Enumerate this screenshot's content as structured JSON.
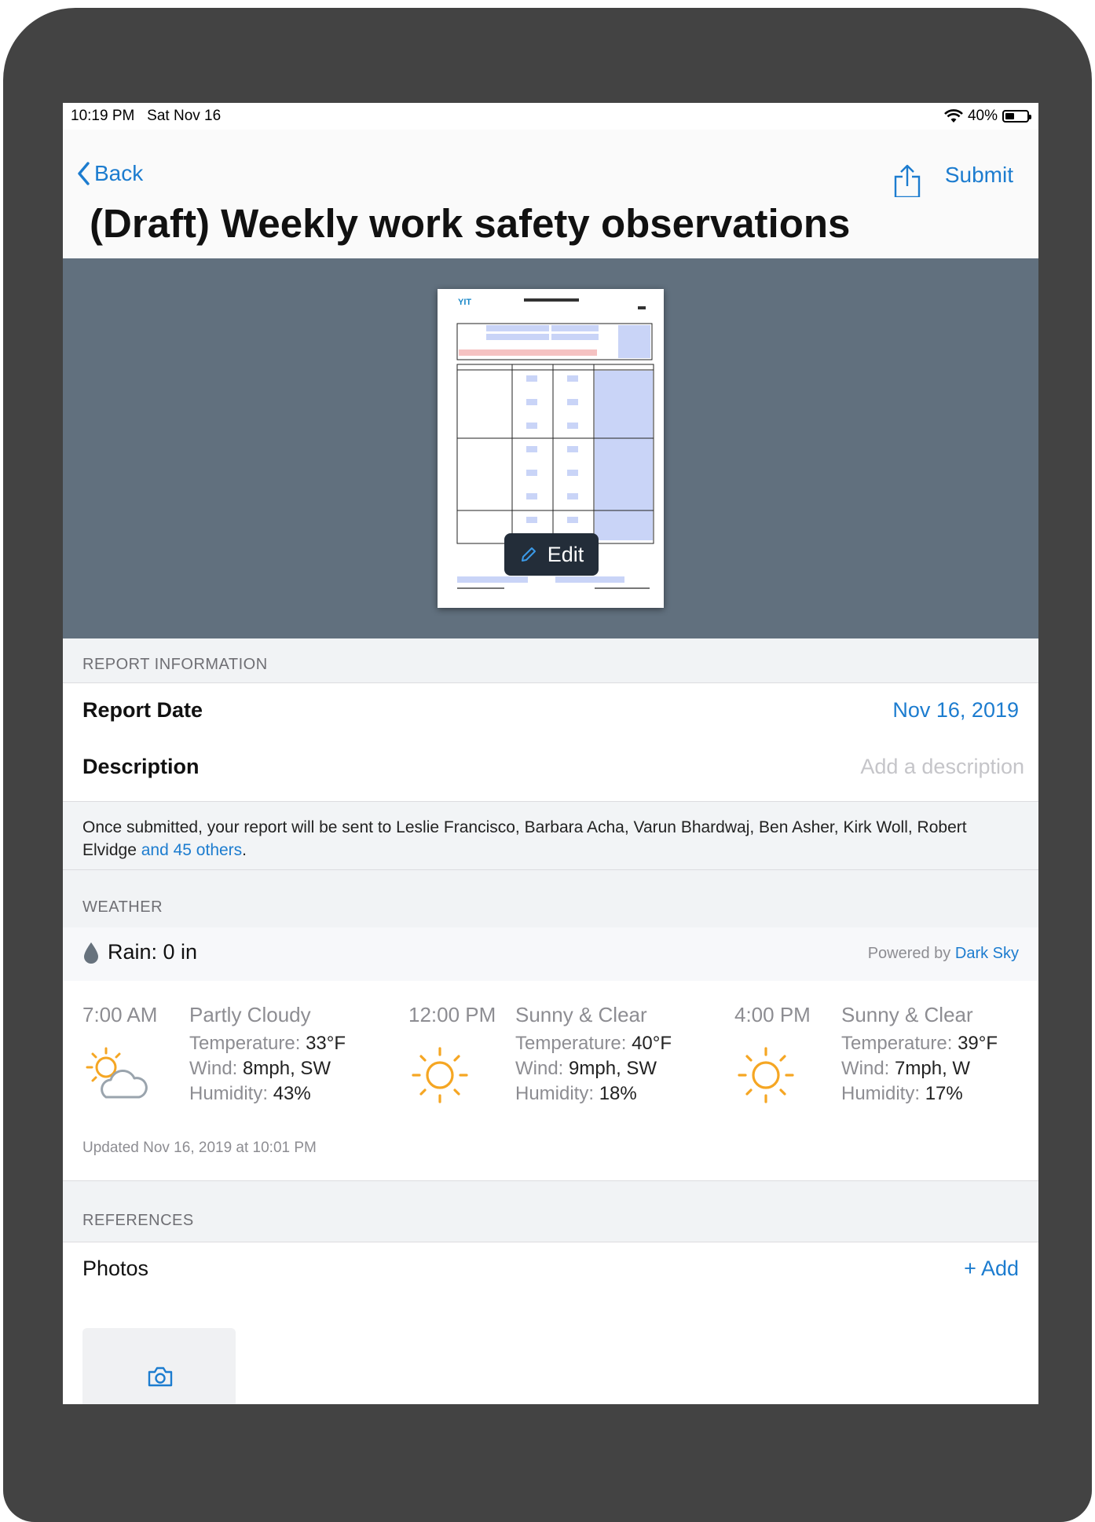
{
  "status_bar": {
    "time": "10:19 PM",
    "date": "Sat Nov 16",
    "battery": "40%"
  },
  "nav": {
    "back_label": "Back",
    "submit_label": "Submit"
  },
  "title": "(Draft) Weekly work safety observations",
  "preview": {
    "edit_label": "Edit"
  },
  "report_info": {
    "header": "REPORT INFORMATION",
    "date_label": "Report Date",
    "date_value": "Nov 16, 2019",
    "description_label": "Description",
    "description_placeholder": "Add a description"
  },
  "notice": {
    "text": "Once submitted, your report will be sent to Leslie Francisco, Barbara Acha, Varun Bhardwaj, Ben Asher, Kirk Woll, Robert Elvidge",
    "link": "and 45 others",
    "end": "."
  },
  "weather": {
    "header": "WEATHER",
    "rain": "Rain: 0 in",
    "powered_prefix": "Powered by",
    "powered_link": "Dark Sky",
    "temperature_label": "Temperature:",
    "wind_label": "Wind:",
    "humidity_label": "Humidity:",
    "forecasts": [
      {
        "time": "7:00 AM",
        "condition": "Partly Cloudy",
        "temperature": "33°F",
        "wind": "8mph, SW",
        "humidity": "43%",
        "icon": "partly-cloudy-icon"
      },
      {
        "time": "12:00 PM",
        "condition": "Sunny & Clear",
        "temperature": "40°F",
        "wind": "9mph, SW",
        "humidity": "18%",
        "icon": "sun-icon"
      },
      {
        "time": "4:00 PM",
        "condition": "Sunny & Clear",
        "temperature": "39°F",
        "wind": "7mph, W",
        "humidity": "17%",
        "icon": "sun-icon"
      }
    ],
    "updated": "Updated Nov 16, 2019 at 10:01 PM"
  },
  "references": {
    "header": "REFERENCES",
    "photos_label": "Photos",
    "add_label": "+ Add"
  },
  "colors": {
    "accent": "#1c7ccf",
    "preview_bg": "#61707e",
    "device": "#434343",
    "sun": "#f5a623"
  }
}
